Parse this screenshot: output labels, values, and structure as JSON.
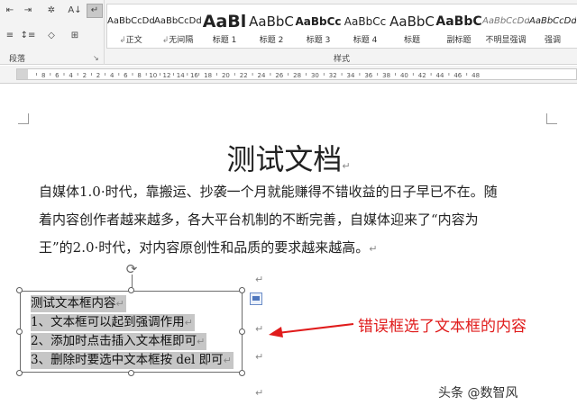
{
  "ribbon": {
    "paragraph_group_label": "段落",
    "styles_group_label": "样式",
    "styles": [
      {
        "sample": "AaBbCcDd",
        "name": "正文",
        "prefix": "↲",
        "size": 10,
        "weight": "normal"
      },
      {
        "sample": "AaBbCcDd",
        "name": "无间隔",
        "prefix": "↲",
        "size": 10,
        "weight": "normal"
      },
      {
        "sample": "AaBl",
        "name": "标题 1",
        "prefix": "",
        "size": 19,
        "weight": "bold"
      },
      {
        "sample": "AaBbC",
        "name": "标题 2",
        "prefix": "",
        "size": 15,
        "weight": "normal"
      },
      {
        "sample": "AaBbCc",
        "name": "标题 3",
        "prefix": "",
        "size": 12,
        "weight": "bold"
      },
      {
        "sample": "AaBbCc",
        "name": "标题 4",
        "prefix": "",
        "size": 12,
        "weight": "normal"
      },
      {
        "sample": "AaBbC",
        "name": "标题",
        "prefix": "",
        "size": 15,
        "weight": "normal"
      },
      {
        "sample": "AaBbC",
        "name": "副标题",
        "prefix": "",
        "size": 14,
        "weight": "bold"
      },
      {
        "sample": "AaBbCcDd",
        "name": "不明显强调",
        "prefix": "",
        "size": 10,
        "weight": "normal",
        "italic": true,
        "color": "#777777"
      },
      {
        "sample": "AaBbCcDd",
        "name": "强调",
        "prefix": "",
        "size": 10,
        "weight": "normal",
        "italic": true
      }
    ]
  },
  "ruler": {
    "left_labels": [
      "8",
      "6",
      "4",
      "2",
      "2",
      "4",
      "6",
      "8",
      "10",
      "12",
      "14",
      "16"
    ],
    "right_labels": [
      "18",
      "20",
      "22",
      "24",
      "26",
      "28",
      "30",
      "32",
      "34",
      "36",
      "38",
      "40",
      "42",
      "44",
      "46",
      "48"
    ]
  },
  "document": {
    "title": "测试文档",
    "paragraph_mark": "↵",
    "paragraph_lines": [
      "自媒体1.0·时代，靠搬运、抄袭一个月就能赚得不错收益的日子早已不在。随",
      "着内容创作者越来越多，各大平台机制的不断完善，自媒体迎来了“内容为",
      "王”的2.0·时代，对内容原创性和品质的要求越来越高。"
    ],
    "textbox_lines": [
      "测试文本框内容",
      "1、文本框可以起到强调作用",
      "2、添加时点击插入文本框即可",
      "3、删除时要选中文本框按 del 即可"
    ]
  },
  "annotation": {
    "text": "错误框选了文本框的内容",
    "color": "#e01b1b"
  },
  "watermark": {
    "text": "头条 @数智风"
  }
}
